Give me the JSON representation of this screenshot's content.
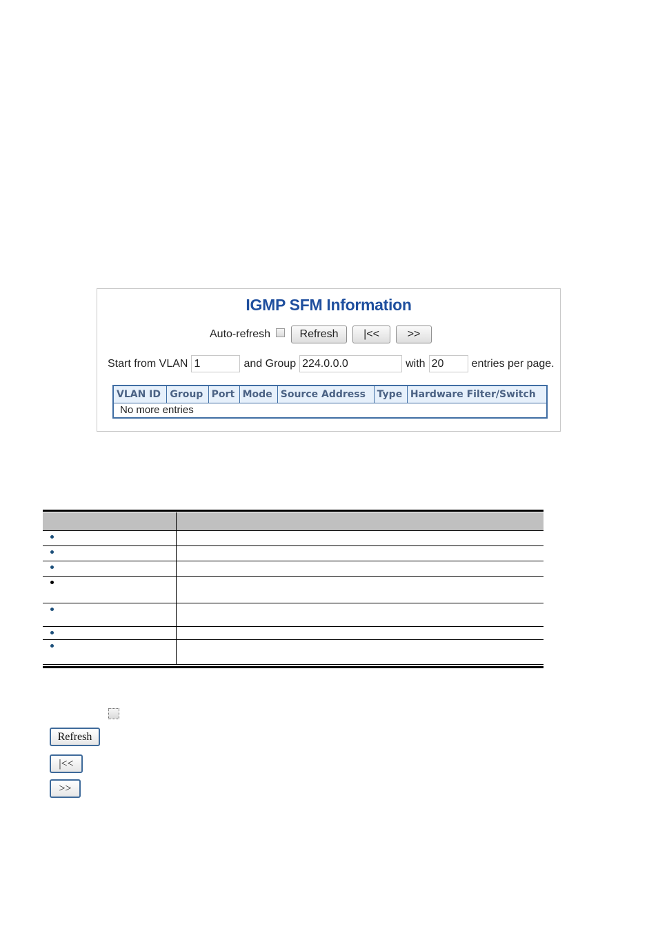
{
  "panel": {
    "title": "IGMP SFM Information",
    "auto_refresh_label": "Auto-refresh",
    "auto_refresh_checked": false,
    "buttons": {
      "refresh": "Refresh",
      "first": "|<<",
      "next": ">>"
    },
    "paging": {
      "start_label": "Start from VLAN",
      "vlan_value": "1",
      "group_label": "and Group",
      "group_value": "224.0.0.0",
      "with_label": "with",
      "per_page_value": "20",
      "entries_label": "entries per page."
    },
    "table": {
      "columns": [
        "VLAN ID",
        "Group",
        "Port",
        "Mode",
        "Source Address",
        "Type",
        "Hardware Filter/Switch"
      ],
      "empty_message": "No more entries"
    },
    "colors": {
      "title": "#1f4f9e",
      "table_border": "#3f6da3",
      "header_bg": "#e6f0fb",
      "header_text": "#4b6284"
    }
  },
  "description_table": {
    "headers": [
      "",
      ""
    ],
    "rows": [
      {
        "object": "",
        "description": ""
      },
      {
        "object": "",
        "description": ""
      },
      {
        "object": "",
        "description": ""
      },
      {
        "object": "",
        "description": ""
      },
      {
        "object": "",
        "description": ""
      },
      {
        "object": "",
        "description": ""
      },
      {
        "object": "",
        "description": ""
      }
    ],
    "header_bg": "#c0c0c0"
  },
  "buttons_legend": {
    "auto_refresh_checked": false,
    "refresh": "Refresh",
    "first": "|<<",
    "next": ">>"
  }
}
